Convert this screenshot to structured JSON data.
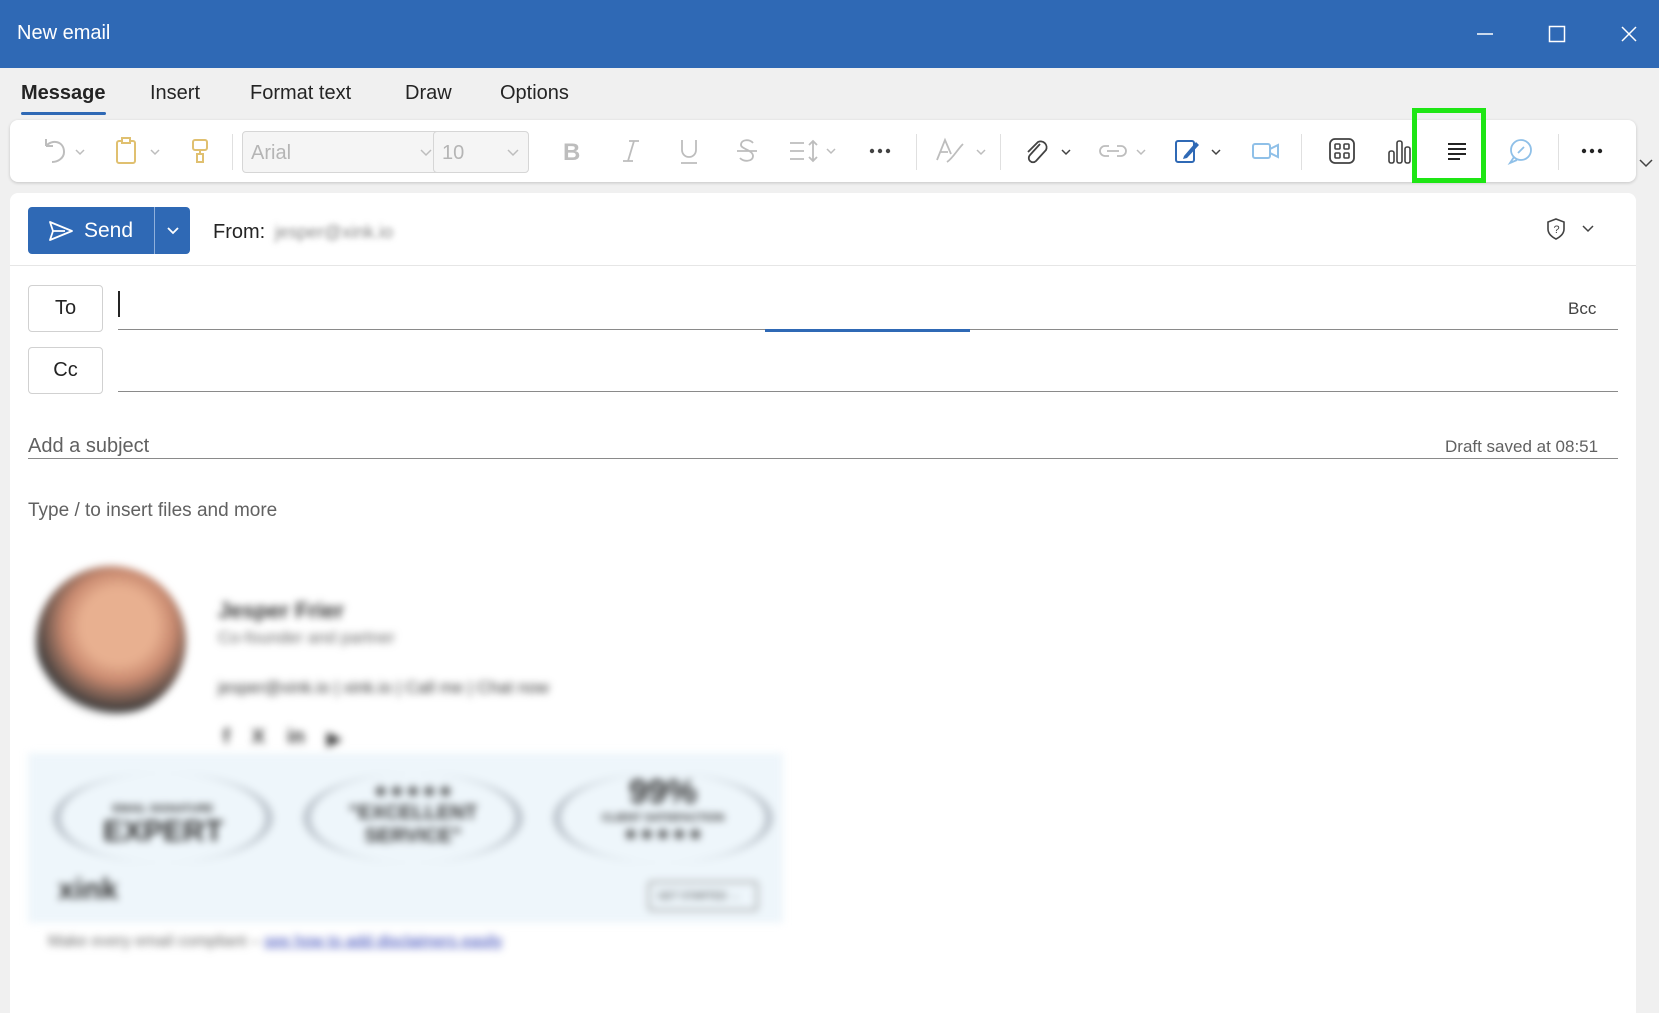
{
  "window": {
    "title": "New email"
  },
  "tabs": [
    "Message",
    "Insert",
    "Format text",
    "Draw",
    "Options"
  ],
  "ribbon": {
    "font_name": "Arial",
    "font_size": "10"
  },
  "compose": {
    "send_label": "Send",
    "from_label": "From:",
    "from_value": "jesper@xink.io",
    "to_label": "To",
    "cc_label": "Cc",
    "bcc_label": "Bcc",
    "subject_placeholder": "Add a subject",
    "draft_status": "Draft saved at 08:51",
    "body_hint": "Type / to insert files and more"
  },
  "signature": {
    "name": "Jesper Frier",
    "role": "Co-founder and partner",
    "contact": "jesper@xink.io | xink.io | Call me | Chat now",
    "badge1_top": "EMAIL SIGNATURE",
    "badge1_main": "EXPERT",
    "badge2_main": "\"EXCELLENT SERVICE\"",
    "badge3_main": "99%",
    "badge3_sub": "CLIENT SATISFACTION",
    "brand": "xink",
    "cta": "GET STARTED →",
    "footer_text": "Make every email compliant – ",
    "footer_link": "see how to add disclaimers easily"
  },
  "colors": {
    "accent": "#2f69b5",
    "highlight": "#1ee614"
  }
}
